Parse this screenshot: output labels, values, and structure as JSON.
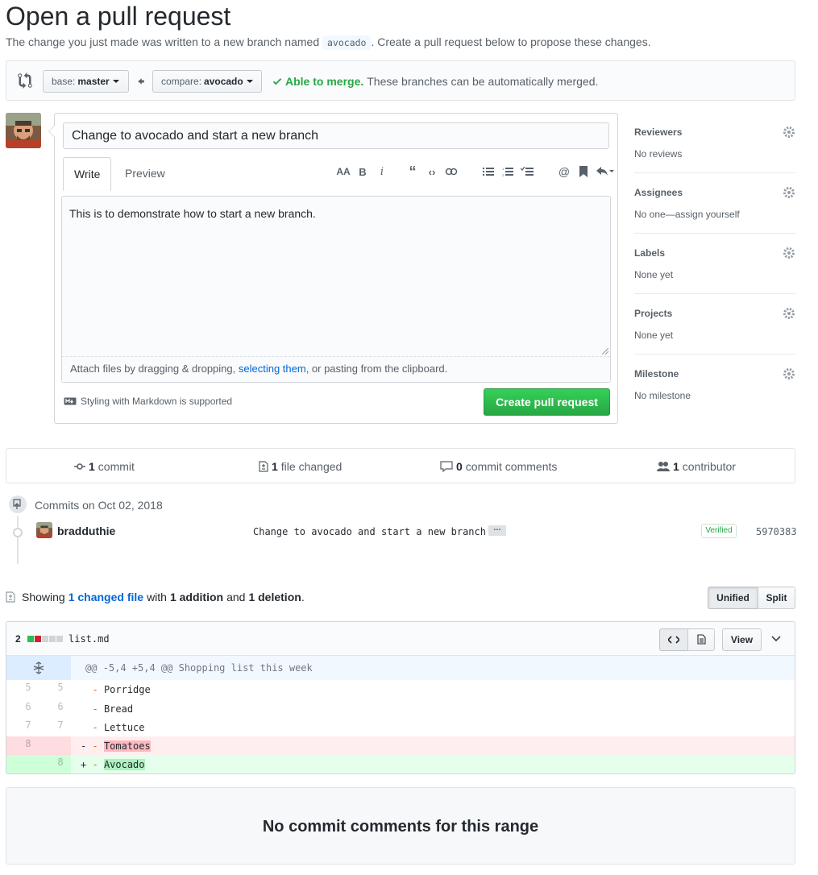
{
  "header": {
    "title": "Open a pull request",
    "subtitle_pre": "The change you just made was written to a new branch named ",
    "branch": "avocado",
    "subtitle_post": ". Create a pull request below to propose these changes."
  },
  "range": {
    "base_label": "base:",
    "base_value": "master",
    "compare_label": "compare:",
    "compare_value": "avocado",
    "merge_ok": "Able to merge.",
    "merge_text": "These branches can be automatically merged."
  },
  "form": {
    "title_value": "Change to avocado and start a new branch",
    "tab_write": "Write",
    "tab_preview": "Preview",
    "body_value": "This is to demonstrate how to start a new branch.",
    "attach_pre": "Attach files by dragging & dropping, ",
    "attach_link": "selecting them",
    "attach_post": ", or pasting from the clipboard.",
    "markdown_note": "Styling with Markdown is supported",
    "submit_label": "Create pull request"
  },
  "sidebar": [
    {
      "title": "Reviewers",
      "value": "No reviews"
    },
    {
      "title": "Assignees",
      "value": "No one—assign yourself"
    },
    {
      "title": "Labels",
      "value": "None yet"
    },
    {
      "title": "Projects",
      "value": "None yet"
    },
    {
      "title": "Milestone",
      "value": "No milestone"
    }
  ],
  "summary": {
    "commits_count": "1",
    "commits_label": "commit",
    "files_count": "1",
    "files_label": "file changed",
    "comments_count": "0",
    "comments_label": "commit comments",
    "contributors_count": "1",
    "contributors_label": "contributor"
  },
  "commits": {
    "date_label": "Commits on Oct 02, 2018",
    "author": "bradduthie",
    "message": "Change to avocado and start a new branch",
    "ellipsis": "…",
    "verified": "Verified",
    "sha": "5970383"
  },
  "diff_summary": {
    "showing": "Showing",
    "changed_link": "1 changed file",
    "with": "with",
    "additions": "1 addition",
    "and": "and",
    "deletions": "1 deletion",
    "period": ".",
    "unified": "Unified",
    "split": "Split"
  },
  "file": {
    "change_count": "2",
    "name": "list.md",
    "view_label": "View",
    "hunk": "@@ -5,4 +5,4 @@ Shopping list this week",
    "lines": [
      {
        "old": "5",
        "new": "5",
        "sign": " ",
        "text": "Porridge"
      },
      {
        "old": "6",
        "new": "6",
        "sign": " ",
        "text": "Bread"
      },
      {
        "old": "7",
        "new": "7",
        "sign": " ",
        "text": "Lettuce"
      },
      {
        "old": "8",
        "new": "",
        "sign": "-",
        "text": "Tomatoes"
      },
      {
        "old": "",
        "new": "8",
        "sign": "+",
        "text": "Avocado"
      }
    ]
  },
  "no_comments": "No commit comments for this range",
  "colors": {
    "accent": "#0366d6",
    "success": "#28a745",
    "deletion": "#cb2431"
  }
}
